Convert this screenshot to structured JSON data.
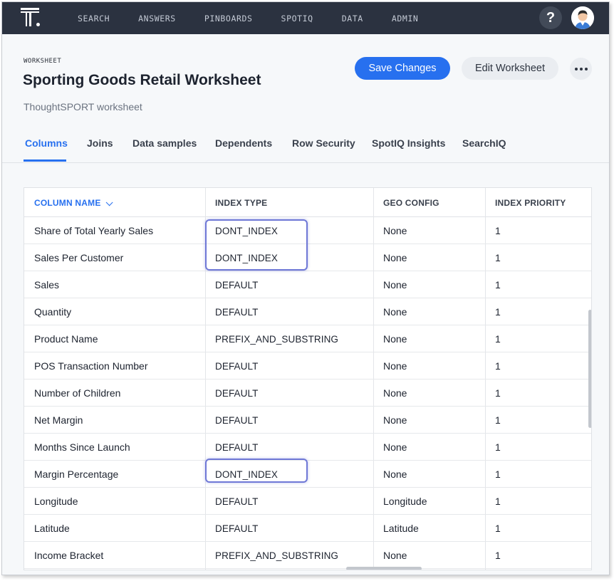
{
  "topnav": {
    "items": [
      "SEARCH",
      "ANSWERS",
      "PINBOARDS",
      "SPOTIQ",
      "DATA",
      "ADMIN"
    ],
    "help_label": "?"
  },
  "header": {
    "label": "WORKSHEET",
    "title": "Sporting Goods Retail Worksheet",
    "subtitle": "ThoughtSPORT worksheet",
    "save_label": "Save Changes",
    "edit_label": "Edit Worksheet"
  },
  "tabs": [
    "Columns",
    "Joins",
    "Data samples",
    "Dependents",
    "Row Security",
    "SpotIQ Insights",
    "SearchIQ"
  ],
  "active_tab": "Columns",
  "table": {
    "headers": [
      "COLUMN NAME",
      "INDEX TYPE",
      "GEO CONFIG",
      "INDEX PRIORITY"
    ],
    "sorted_column": "COLUMN NAME",
    "rows": [
      [
        "Share of Total Yearly Sales",
        "DONT_INDEX",
        "None",
        "1"
      ],
      [
        "Sales Per Customer",
        "DONT_INDEX",
        "None",
        "1"
      ],
      [
        "Sales",
        "DEFAULT",
        "None",
        "1"
      ],
      [
        "Quantity",
        "DEFAULT",
        "None",
        "1"
      ],
      [
        "Product Name",
        "PREFIX_AND_SUBSTRING",
        "None",
        "1"
      ],
      [
        "POS Transaction Number",
        "DEFAULT",
        "None",
        "1"
      ],
      [
        "Number of Children",
        "DEFAULT",
        "None",
        "1"
      ],
      [
        "Net Margin",
        "DEFAULT",
        "None",
        "1"
      ],
      [
        "Months Since Launch",
        "DEFAULT",
        "None",
        "1"
      ],
      [
        "Margin Percentage",
        "DONT_INDEX",
        "None",
        "1"
      ],
      [
        "Longitude",
        "DEFAULT",
        "Longitude",
        "1"
      ],
      [
        "Latitude",
        "DEFAULT",
        "Latitude",
        "1"
      ],
      [
        "Income Bracket",
        "PREFIX_AND_SUBSTRING",
        "None",
        "1"
      ]
    ]
  },
  "colors": {
    "nav_bg": "#2b3240",
    "accent": "#2770ef",
    "highlight": "#6f78d6"
  }
}
